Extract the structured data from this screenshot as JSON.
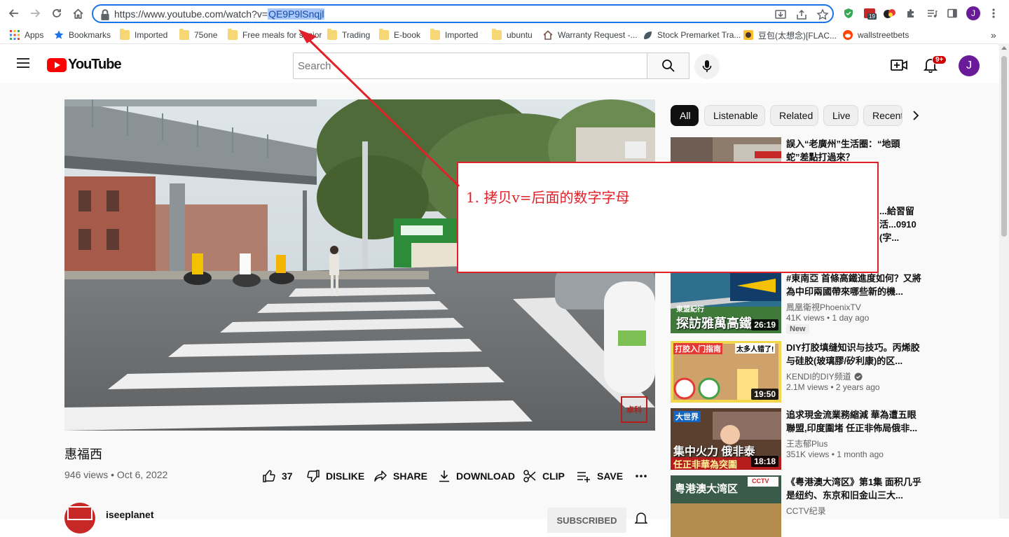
{
  "browser": {
    "url_prefix": "https://www.youtube.com/watch?v=",
    "url_selected": "QE9P9lSnqjl",
    "ext_badge": "19",
    "profile_initial": "J"
  },
  "bookmarks": [
    {
      "label": "Apps",
      "icon": "apps-grid-icon"
    },
    {
      "label": "Bookmarks",
      "icon": "star-icon"
    },
    {
      "label": "Imported",
      "icon": "folder-icon"
    },
    {
      "label": "75one",
      "icon": "folder-icon"
    },
    {
      "label": "Free meals for senior",
      "icon": "folder-icon"
    },
    {
      "label": "Trading",
      "icon": "folder-icon"
    },
    {
      "label": "E-book",
      "icon": "folder-icon"
    },
    {
      "label": "Imported",
      "icon": "folder-icon"
    },
    {
      "label": "ubuntu",
      "icon": "folder-icon"
    },
    {
      "label": "Warranty Request -...",
      "icon": "house-icon"
    },
    {
      "label": "Stock Premarket Tra...",
      "icon": "leaf-icon"
    },
    {
      "label": "豆包(太想念)[FLAC...",
      "icon": "site-icon"
    },
    {
      "label": "wallstreetbets",
      "icon": "reddit-icon"
    }
  ],
  "youtube": {
    "logo_text": "YouTube",
    "search_placeholder": "Search",
    "notif_count": "9+",
    "avatar_initial": "J"
  },
  "video": {
    "title": "惠福西",
    "meta": "946 views • Oct 6, 2022",
    "likes": "37",
    "dislike": "DISLIKE",
    "share": "SHARE",
    "download": "DOWNLOAD",
    "clip": "CLIP",
    "save": "SAVE",
    "channel": "iseeplanet",
    "subscribed": "SUBSCRIBED",
    "seal_text": "卓科"
  },
  "chips": [
    "All",
    "Listenable",
    "Related",
    "Live",
    "Recent"
  ],
  "recommendations": [
    {
      "title": "誤入“老廣州”生活圈：“地頭蛇”差點打過來？",
      "channel": "",
      "meta": "",
      "duration": ""
    },
    {
      "title": "...給習留活...0910 (字...",
      "channel": "",
      "meta": "",
      "duration": ""
    },
    {
      "title": "#東南亞 首條高鐵進度如何？又將為中印兩國帶來哪些新的機...",
      "channel": "鳳凰衛視PhoenixTV",
      "meta": "41K views • 1 day ago",
      "duration": "26:19",
      "badge": "New",
      "thumb_text": "探訪雅萬高鐵",
      "thumb_sub": "東盟紀行"
    },
    {
      "title": "DIY打胶填缝知识与技巧。丙烯胶与硅胶(玻璃膠/矽利康)的区...",
      "channel": "KENDI的DIY频道",
      "meta": "2.1M views • 2 years ago",
      "duration": "19:50",
      "thumb_text": "打胶入门指南",
      "thumb_sub": "太多人错了!"
    },
    {
      "title": "追求現金流業務縮減 華為遭五眼聯盟,印度圍堵 任正非佈局俄非...",
      "channel": "王志郁Plus",
      "meta": "351K views • 1 month ago",
      "duration": "18:18",
      "thumb_text": "集中火力 俄非泰",
      "thumb_sub": "任正非華為突圍",
      "thumb_top": "大世界"
    },
    {
      "title": "《粤港澳大湾区》第1集 面积几乎是纽约、东京和旧金山三大...",
      "channel": "CCTV纪录",
      "meta": "",
      "duration": "",
      "thumb_text": "粤港澳大湾区",
      "thumb_sub": "CCTV"
    }
  ],
  "annotation": {
    "text": "1. 拷贝v=后面的数字字母",
    "arrow_color": "#e0212a"
  },
  "colors": {
    "youtube_red": "#ff0000",
    "chrome_focus": "#1a73e8",
    "annotation_red": "#e0212a",
    "avatar_purple": "#6a1b9a"
  }
}
